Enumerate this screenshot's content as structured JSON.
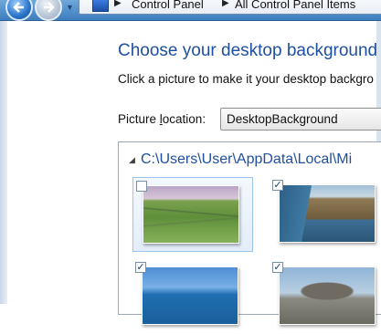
{
  "address_bar": {
    "icon": "control-panel-icon",
    "crumbs": [
      "Control Panel",
      "All Control Panel Items"
    ]
  },
  "nav": {
    "back_icon": "back-arrow-icon",
    "forward_icon": "forward-arrow-icon",
    "dropdown_icon": "chevron-down-icon"
  },
  "page": {
    "title": "Choose your desktop background",
    "subtitle": "Click a picture to make it your desktop backgro"
  },
  "picture_location": {
    "label": "Picture location:",
    "value": "DesktopBackground"
  },
  "picture_list": {
    "group_path": "C:\\Users\\User\\AppData\\Local\\Mi",
    "items": [
      {
        "checked": false,
        "scene": "green-fields-stone-walls"
      },
      {
        "checked": true,
        "scene": "sea-cliffs"
      },
      {
        "checked": true,
        "scene": "blue-coast"
      },
      {
        "checked": true,
        "scene": "stone-dolmen"
      }
    ]
  },
  "colors": {
    "heading": "#1f4fa0",
    "selection_border": "#9cc3ea"
  }
}
